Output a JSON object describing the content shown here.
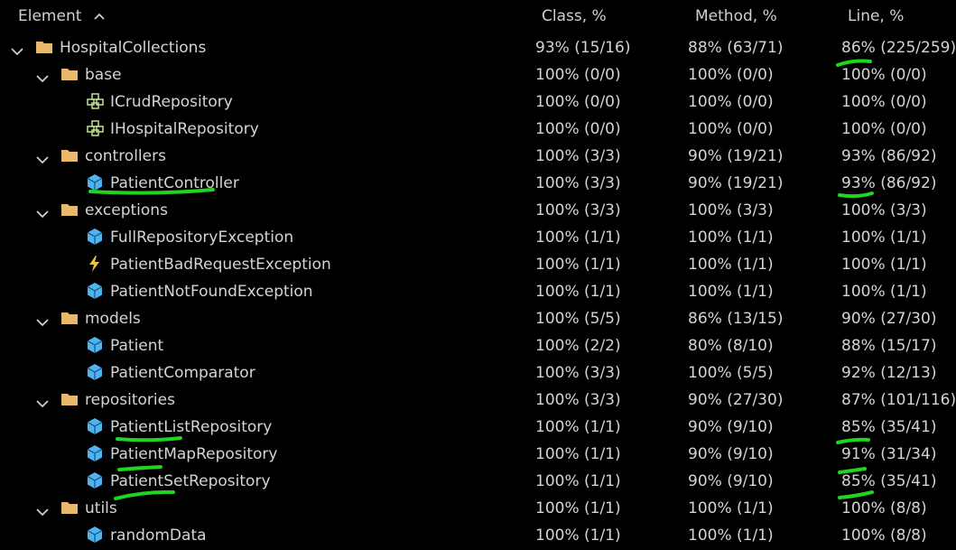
{
  "header": {
    "element": "Element",
    "class": "Class, %",
    "method": "Method, %",
    "line": "Line, %"
  },
  "colors": {
    "highlight": "#1fd51f",
    "folder": "#e8b86b",
    "class_icon": "#4fb3f0",
    "interface_icon": "#b6d98a",
    "exception_icon": "#f0c040"
  },
  "rows": [
    {
      "level": 0,
      "icon": "folder-icon",
      "expanded": true,
      "name": "HospitalCollections",
      "class": "93% (15/16)",
      "method": "88% (63/71)",
      "line": "86% (225/259)"
    },
    {
      "level": 1,
      "icon": "folder-icon",
      "expanded": true,
      "name": "base",
      "class": "100% (0/0)",
      "method": "100% (0/0)",
      "line": "100% (0/0)"
    },
    {
      "level": 2,
      "icon": "interface-icon",
      "name": "ICrudRepository",
      "class": "100% (0/0)",
      "method": "100% (0/0)",
      "line": "100% (0/0)"
    },
    {
      "level": 2,
      "icon": "interface-icon",
      "name": "IHospitalRepository",
      "class": "100% (0/0)",
      "method": "100% (0/0)",
      "line": "100% (0/0)"
    },
    {
      "level": 1,
      "icon": "folder-icon",
      "expanded": true,
      "name": "controllers",
      "class": "100% (3/3)",
      "method": "90% (19/21)",
      "line": "93% (86/92)"
    },
    {
      "level": 2,
      "icon": "class-icon",
      "name": "PatientController",
      "class": "100% (3/3)",
      "method": "90% (19/21)",
      "line": "93% (86/92)"
    },
    {
      "level": 1,
      "icon": "folder-icon",
      "expanded": true,
      "name": "exceptions",
      "class": "100% (3/3)",
      "method": "100% (3/3)",
      "line": "100% (3/3)"
    },
    {
      "level": 2,
      "icon": "class-icon",
      "name": "FullRepositoryException",
      "class": "100% (1/1)",
      "method": "100% (1/1)",
      "line": "100% (1/1)"
    },
    {
      "level": 2,
      "icon": "exception-icon",
      "name": "PatientBadRequestException",
      "class": "100% (1/1)",
      "method": "100% (1/1)",
      "line": "100% (1/1)"
    },
    {
      "level": 2,
      "icon": "class-icon",
      "name": "PatientNotFoundException",
      "class": "100% (1/1)",
      "method": "100% (1/1)",
      "line": "100% (1/1)"
    },
    {
      "level": 1,
      "icon": "folder-icon",
      "expanded": true,
      "name": "models",
      "class": "100% (5/5)",
      "method": "86% (13/15)",
      "line": "90% (27/30)"
    },
    {
      "level": 2,
      "icon": "class-icon",
      "name": "Patient",
      "class": "100% (2/2)",
      "method": "80% (8/10)",
      "line": "88% (15/17)"
    },
    {
      "level": 2,
      "icon": "class-icon",
      "name": "PatientComparator",
      "class": "100% (3/3)",
      "method": "100% (5/5)",
      "line": "92% (12/13)"
    },
    {
      "level": 1,
      "icon": "folder-icon",
      "expanded": true,
      "name": "repositories",
      "class": "100% (3/3)",
      "method": "90% (27/30)",
      "line": "87% (101/116)"
    },
    {
      "level": 2,
      "icon": "class-icon",
      "name": "PatientListRepository",
      "class": "100% (1/1)",
      "method": "90% (9/10)",
      "line": "85% (35/41)"
    },
    {
      "level": 2,
      "icon": "class-icon",
      "name": "PatientMapRepository",
      "class": "100% (1/1)",
      "method": "90% (9/10)",
      "line": "91% (31/34)"
    },
    {
      "level": 2,
      "icon": "class-icon",
      "name": "PatientSetRepository",
      "class": "100% (1/1)",
      "method": "90% (9/10)",
      "line": "85% (35/41)"
    },
    {
      "level": 1,
      "icon": "folder-icon",
      "expanded": true,
      "name": "utils",
      "class": "100% (1/1)",
      "method": "100% (1/1)",
      "line": "100% (8/8)"
    },
    {
      "level": 2,
      "icon": "class-icon",
      "name": "randomData",
      "class": "100% (1/1)",
      "method": "100% (1/1)",
      "line": "100% (8/8)"
    }
  ]
}
